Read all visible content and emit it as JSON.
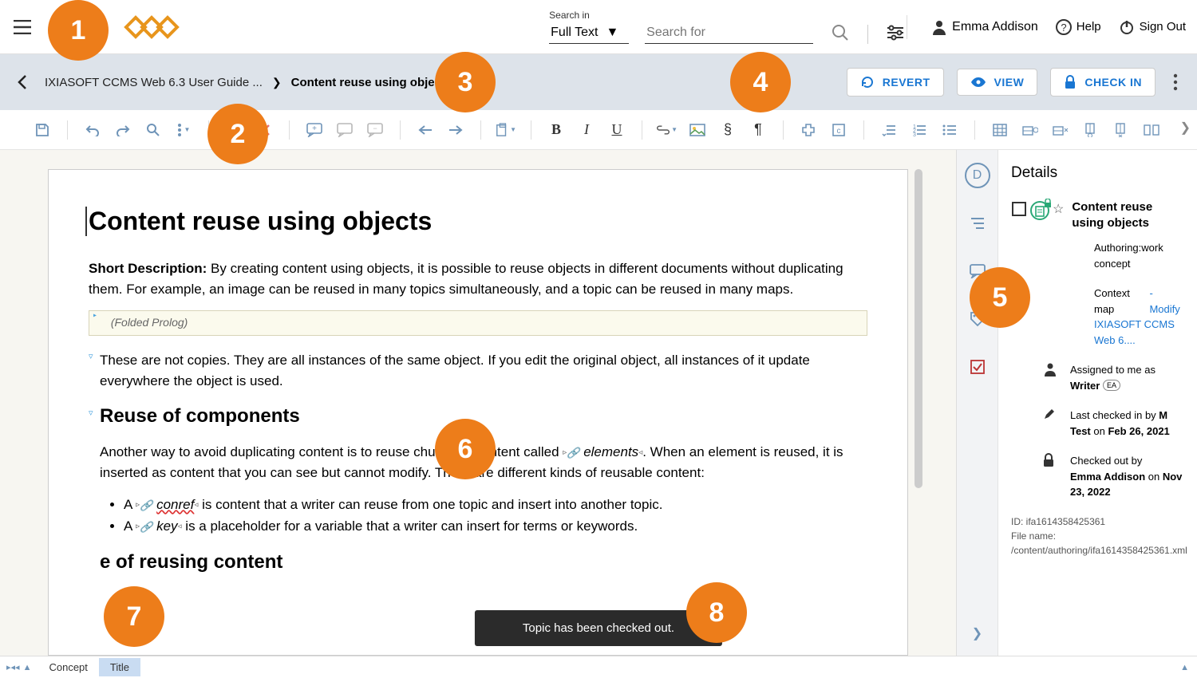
{
  "header": {
    "search_in_label": "Search in",
    "search_in_value": "Full Text",
    "search_for_placeholder": "Search for",
    "user_name": "Emma Addison",
    "help_label": "Help",
    "signout_label": "Sign Out"
  },
  "crumb": {
    "root": "IXIASOFT CCMS Web 6.3 User Guide ...",
    "leaf": "Content reuse using objects",
    "revert": "REVERT",
    "view": "VIEW",
    "checkin": "CHECK IN"
  },
  "doc": {
    "title": "Content reuse using objects",
    "shortdesc_label": "Short Description:",
    "shortdesc_text": "By creating content using objects, it is possible to reuse objects in different documents without duplicating them. For example, an image can be reused in many topics simultaneously, and a topic can be reused in many maps.",
    "prolog": "(Folded Prolog)",
    "para1": "These are not copies. They are all instances of the same object. If you edit the original object, all instances of it update everywhere the object is used.",
    "section1_title": "Reuse of components",
    "para2a": "Another way to avoid duplicating content is to reuse chunks of content called ",
    "elements_word": "elements",
    "para2b": ". When an element is reused, it is inserted as content that you can see but cannot modify. There are different kinds of reusable content:",
    "bullets": [
      {
        "pre": "A ",
        "el": "conref",
        "post": " is content that a writer can reuse from one topic and insert into another topic."
      },
      {
        "pre": "A ",
        "el": "key",
        "post": " is a placeholder for a variable that a writer can insert for terms or keywords."
      }
    ],
    "section2_title": "e of reusing content"
  },
  "details": {
    "heading": "Details",
    "doc_title": "Content reuse using objects",
    "status": "Authoring:work",
    "type": "concept",
    "context_label": "Context map",
    "modify": "- Modify",
    "context_value": "IXIASOFT CCMS Web 6....",
    "assigned_label": "Assigned to me as",
    "assigned_role": "Writer",
    "assigned_badge": "EA",
    "checkin_label": "Last checked in by ",
    "checkin_user": "M Test",
    "checkin_on": " on ",
    "checkin_date": "Feb 26, 2021",
    "checkout_label": "Checked out by",
    "checkout_user": "Emma Addison",
    "checkout_on": " on ",
    "checkout_date": "Nov 23, 2022",
    "id_label": "ID: ",
    "id_val": "ifa1614358425361",
    "file_label": "File name: ",
    "file_val": "/content/authoring/ifa1614358425361.xml"
  },
  "status": {
    "concept": "Concept",
    "title": "Title"
  },
  "toast": "Topic has been checked out.",
  "annotations": [
    "1",
    "2",
    "3",
    "4",
    "5",
    "6",
    "7",
    "8"
  ]
}
